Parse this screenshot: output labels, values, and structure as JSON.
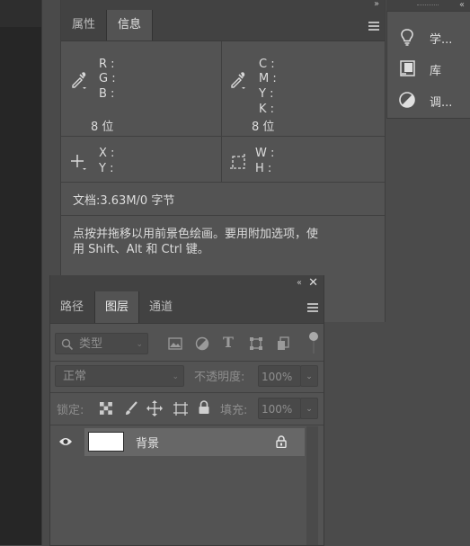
{
  "info_panel": {
    "collapse_glyph": "››",
    "tabs": [
      {
        "label": "属性",
        "active": false
      },
      {
        "label": "信息",
        "active": true
      }
    ],
    "rgb": {
      "r": "R :",
      "g": "G :",
      "b": "B :",
      "bits": "8 位"
    },
    "cmyk": {
      "c": "C :",
      "m": "M :",
      "y": "Y :",
      "k": "K :",
      "bits": "8 位"
    },
    "xy": {
      "x": "X :",
      "y": "Y :"
    },
    "wh": {
      "w": "W :",
      "h": "H :"
    },
    "doc": "文档:3.63M/0 字节",
    "hint_line1": "点按并拖移以用前景色绘画。要用附加选项，使",
    "hint_line2": "用 Shift、Alt 和 Ctrl 键。"
  },
  "right_panel": {
    "collapse_glyph": "‹‹",
    "items": [
      {
        "label": "学...",
        "icon": "lightbulb-icon"
      },
      {
        "label": "库",
        "icon": "library-icon"
      },
      {
        "label": "调...",
        "icon": "adjustments-icon"
      }
    ]
  },
  "layers_panel": {
    "collapse_glyph": "‹‹",
    "close_glyph": "✕",
    "tabs": [
      {
        "label": "路径",
        "active": false
      },
      {
        "label": "图层",
        "active": true
      },
      {
        "label": "通道",
        "active": false
      }
    ],
    "filter_placeholder": "类型",
    "blend_mode": "正常",
    "opacity_label": "不透明度:",
    "opacity_value": "100%",
    "lock_label": "锁定:",
    "fill_label": "填充:",
    "fill_value": "100%",
    "layers": [
      {
        "name": "背景",
        "visible": true,
        "locked": true
      }
    ]
  }
}
